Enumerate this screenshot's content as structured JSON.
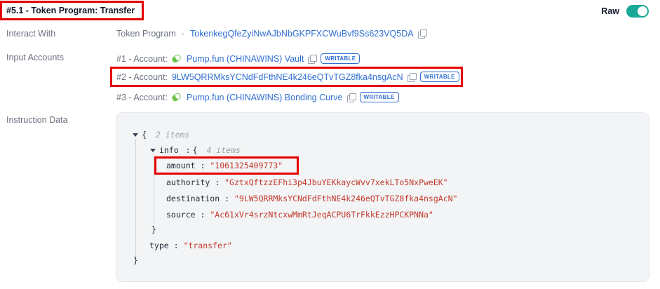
{
  "header": {
    "title": "#5.1 - Token Program: Transfer",
    "raw_label": "Raw",
    "raw_on": true
  },
  "interact_with": {
    "label": "Interact With",
    "program_name": "Token Program",
    "separator": "-",
    "program_address": "TokenkegQfeZyiNwAJbNbGKPFXCWuBvf9Ss623VQ5DA",
    "copy_icon": "copy-icon"
  },
  "input_accounts": {
    "label": "Input Accounts",
    "accounts": [
      {
        "index": "#1 - Account:",
        "name": "Pump.fun (CHINAWINS) Vault",
        "badge": "WRITABLE",
        "icon": "pill-icon"
      },
      {
        "index": "#2 - Account:",
        "name": "9LW5QRRMksYCNdFdFthNE4k246eQTvTGZ8fka4nsgAcN",
        "badge": "WRITABLE"
      },
      {
        "index": "#3 - Account:",
        "name": "Pump.fun (CHINAWINS) Bonding Curve",
        "badge": "WRITABLE",
        "icon": "pill-icon"
      }
    ]
  },
  "instruction_data": {
    "label": "Instruction Data",
    "root_open": "{",
    "root_count": "2 items",
    "info_key": "info",
    "colon": ":",
    "info_open": "{",
    "info_count": "4 items",
    "fields": [
      {
        "key": "amount",
        "value": "\"1061325409773\""
      },
      {
        "key": "authority",
        "value": "\"GztxQftzzEFhi3p4JbuYEKkaycWvv7xekLTo5NxPweEK\""
      },
      {
        "key": "destination",
        "value": "\"9LW5QRRMksYCNdFdFthNE4k246eQTvTGZ8fka4nsgAcN\""
      },
      {
        "key": "source",
        "value": "\"Ac61xVr4srzNtcxwMmRtJeqACPU6TrFkkEzzHPCKPNNa\""
      }
    ],
    "info_close": "}",
    "type_key": "type",
    "type_value": "\"transfer\"",
    "root_close": "}"
  },
  "colors": {
    "link": "#2f6fd1",
    "toggle": "#1aa898",
    "highlight": "#e60000",
    "string": "#c0392b"
  }
}
